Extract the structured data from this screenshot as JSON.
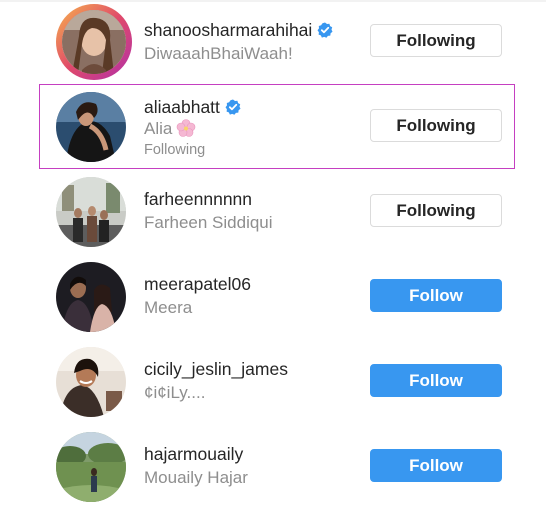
{
  "users": [
    {
      "username": "shanoosharmarahihai",
      "verified": true,
      "fullname": "DiwaaahBhaiWaah!",
      "subtitle": "",
      "button": "Following",
      "story_ring": true,
      "avatar": "woman-selfie-avatar"
    },
    {
      "username": "aliaabhatt",
      "verified": true,
      "fullname": "Alia",
      "emoji": "cherry-blossom-icon",
      "subtitle": "Following",
      "button": "Following",
      "highlighted": true,
      "avatar": "woman-dark-dress-avatar"
    },
    {
      "username": "farheennnnnn",
      "verified": false,
      "fullname": "Farheen Siddiqui",
      "subtitle": "",
      "button": "Following",
      "avatar": "group-photo-avatar"
    },
    {
      "username": "meerapatel06",
      "verified": false,
      "fullname": "Meera",
      "subtitle": "",
      "button": "Follow",
      "avatar": "couple-photo-avatar"
    },
    {
      "username": "cicily_jeslin_james",
      "verified": false,
      "fullname": "¢i¢iLy....",
      "subtitle": "",
      "button": "Follow",
      "avatar": "smiling-woman-avatar"
    },
    {
      "username": "hajarmouaily",
      "verified": false,
      "fullname": "Mouaily Hajar",
      "subtitle": "",
      "button": "Follow",
      "avatar": "garden-photo-avatar"
    }
  ],
  "colors": {
    "follow_blue": "#3897f0",
    "highlight_border": "#c53fc1",
    "verified_blue": "#3897f0"
  }
}
